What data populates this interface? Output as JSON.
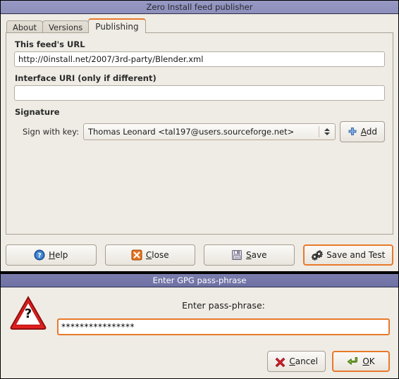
{
  "main_window": {
    "title": "Zero Install feed publisher",
    "tabs": [
      {
        "label": "About",
        "active": false
      },
      {
        "label": "Versions",
        "active": false
      },
      {
        "label": "Publishing",
        "active": true
      }
    ],
    "publishing": {
      "feed_url_label": "This feed's URL",
      "feed_url_value": "http://0install.net/2007/3rd-party/Blender.xml",
      "interface_uri_label": "Interface URI (only if different)",
      "interface_uri_value": "",
      "signature_label": "Signature",
      "sign_with_key_label": "Sign with key:",
      "sign_with_key_value": "Thomas Leonard <tal197@users.sourceforge.net>",
      "add_button": "Add",
      "add_button_mnemonic": "A"
    },
    "actions": [
      {
        "label": "Help",
        "mnemonic": "H",
        "icon": "help-icon",
        "focused": false
      },
      {
        "label": "Close",
        "mnemonic": "C",
        "icon": "close-icon",
        "focused": false
      },
      {
        "label": "Save",
        "mnemonic": "S",
        "icon": "save-icon",
        "focused": false
      },
      {
        "label": "Save and Test",
        "mnemonic": "",
        "icon": "execute-gears-icon",
        "focused": true
      }
    ]
  },
  "gpg_dialog": {
    "title": "Enter GPG pass-phrase",
    "icon": "question-warning-triangle-icon",
    "prompt": "Enter pass-phrase:",
    "passphrase_value": "****************",
    "passphrase_placeholder": "",
    "buttons": [
      {
        "label": "Cancel",
        "mnemonic": "C",
        "icon": "cancel-x-icon",
        "focused": false
      },
      {
        "label": "OK",
        "mnemonic": "O",
        "icon": "ok-enter-arrow-icon",
        "focused": true
      }
    ]
  },
  "colors": {
    "accent_focus": "#e8792a",
    "titlebar_active": "#7b7dae",
    "titlebar_inactive": "#9799c4",
    "window_bg": "#efece5"
  }
}
